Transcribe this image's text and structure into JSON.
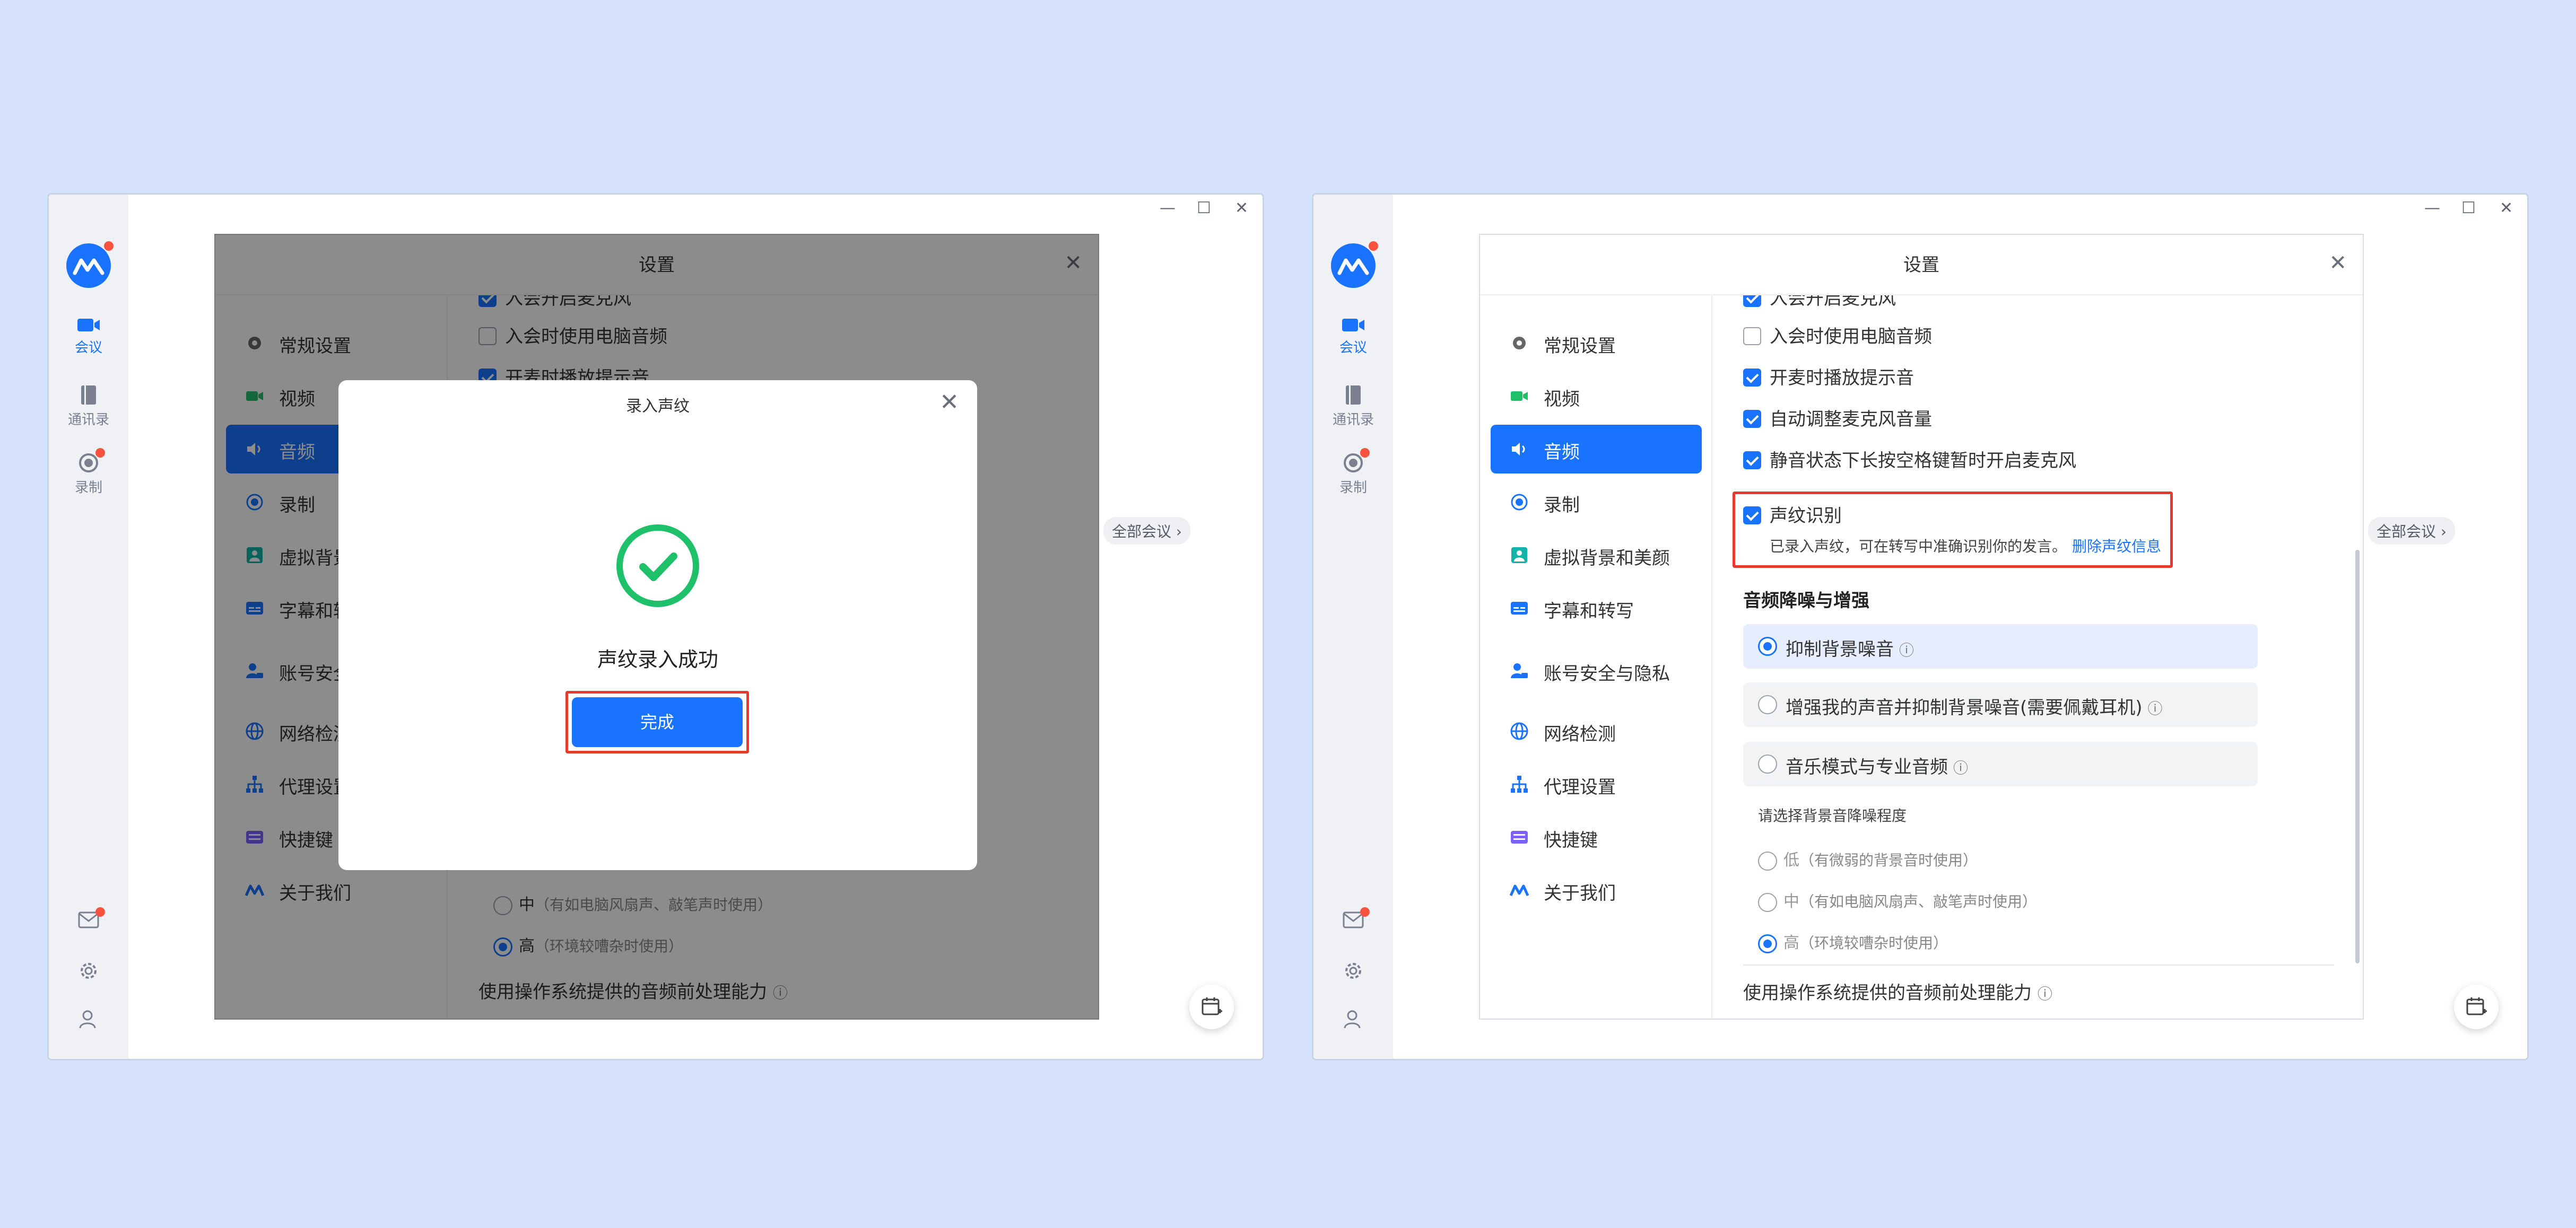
{
  "rail": {
    "meeting_label": "会议",
    "contacts_label": "通讯录",
    "recording_label": "录制"
  },
  "window_controls": {
    "minimize": "—",
    "maximize": "☐",
    "close": "✕"
  },
  "all_meetings": "全部会议 ›",
  "settings": {
    "title": "设置",
    "close": "✕",
    "nav": [
      {
        "label": "常规设置",
        "icon": "gear-icon"
      },
      {
        "label": "视频",
        "icon": "camera-icon"
      },
      {
        "label": "音频",
        "icon": "speaker-icon"
      },
      {
        "label": "录制",
        "icon": "record-icon"
      },
      {
        "label": "虚拟背景和美颜",
        "icon": "portrait-icon"
      },
      {
        "label": "字幕和转写",
        "icon": "caption-icon"
      },
      {
        "label": "账号安全与隐私",
        "icon": "account-lock-icon"
      },
      {
        "label": "网络检测",
        "icon": "globe-icon"
      },
      {
        "label": "代理设置",
        "icon": "network-tree-icon"
      },
      {
        "label": "快捷键",
        "icon": "keyboard-icon"
      },
      {
        "label": "关于我们",
        "icon": "brand-icon"
      }
    ],
    "nav_truncated": {
      "virtual_bg": "虚拟背景",
      "captions": "字幕和转",
      "account": "账号安全"
    },
    "audio": {
      "top_partial": "入会开启麦克风",
      "use_pc_audio": "入会时使用电脑音频",
      "mic_tone": "开麦时播放提示音",
      "auto_adjust": "自动调整麦克风音量",
      "space_unmute": "静音状态下长按空格键暂时开启麦克风",
      "voiceprint": "声纹识别",
      "voiceprint_desc": "已录入声纹，可在转写中准确识别你的发言。",
      "voiceprint_delete": "删除声纹信息",
      "noise_section": "音频降噪与增强",
      "opt_suppress": "抑制背景噪音",
      "opt_enhance": "增强我的声音并抑制背景噪音(需要佩戴耳机)",
      "opt_music": "音乐模式与专业音频",
      "level_prompt": "请选择背景音降噪程度",
      "level_low": "低",
      "level_low_hint": "（有微弱的背景音时使用）",
      "level_mid": "中",
      "level_mid_hint": "（有如电脑风扇声、敲笔声时使用）",
      "level_high": "高",
      "level_high_hint": "（环境较嘈杂时使用）",
      "os_processing": "使用操作系统提供的音频前处理能力",
      "info_glyph": "ⓘ"
    }
  },
  "modal": {
    "title": "录入声纹",
    "close": "✕",
    "success": "声纹录入成功",
    "done": "完成"
  },
  "colors": {
    "accent": "#1a73ff",
    "success": "#1fc06a",
    "highlight": "#e43b2f",
    "background": "#d6e2fb"
  }
}
